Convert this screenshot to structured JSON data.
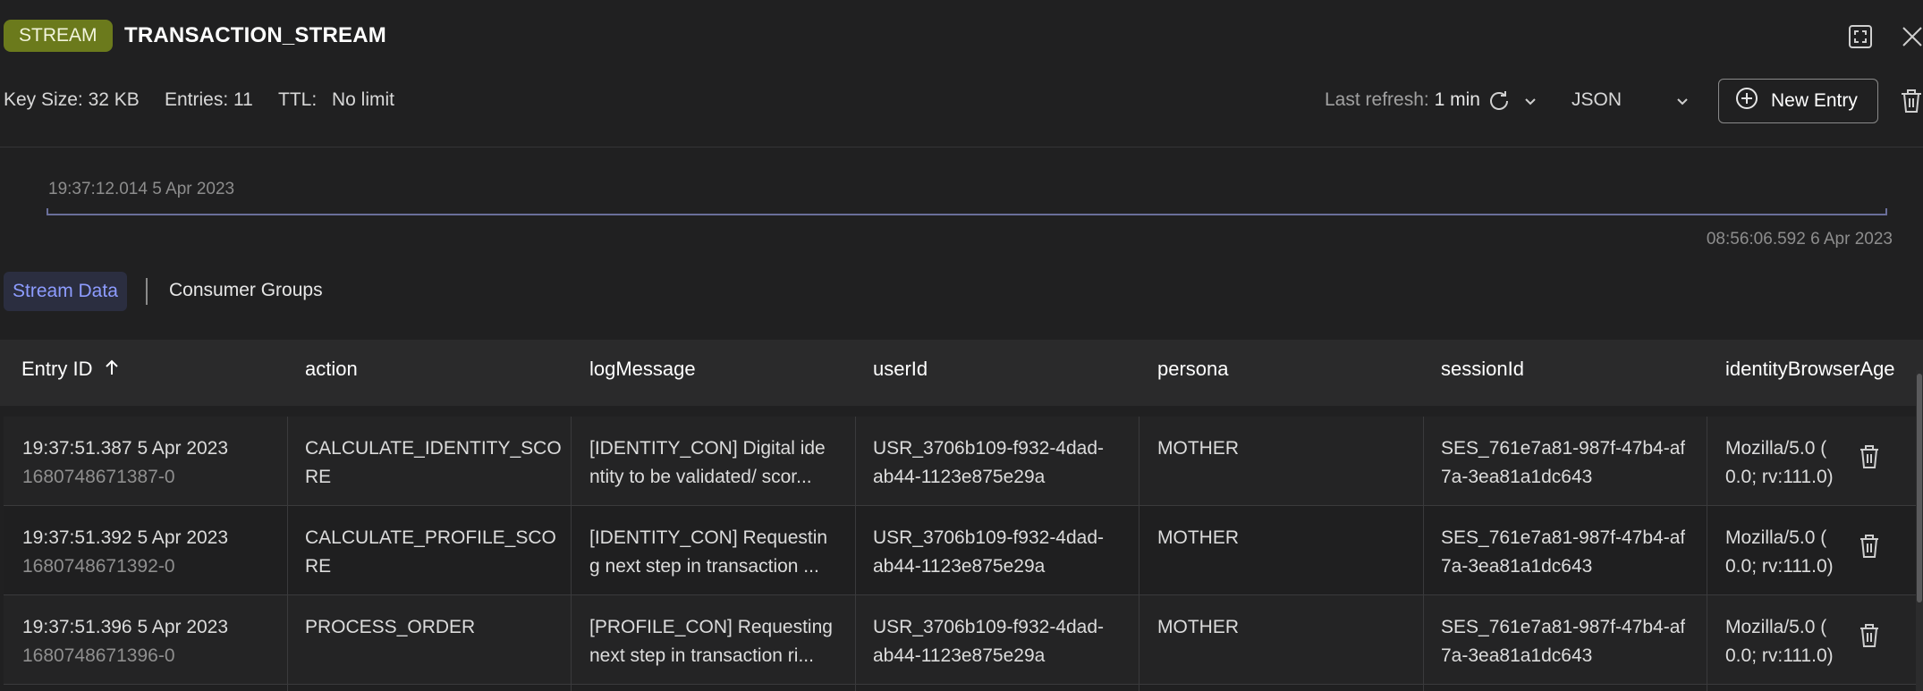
{
  "header": {
    "badge": "STREAM",
    "key_name": "TRANSACTION_STREAM",
    "key_size_label": "Key Size:",
    "key_size": "32 KB",
    "entries_label": "Entries:",
    "entries": "11",
    "ttl_label": "TTL:",
    "ttl": "No limit",
    "last_refresh_label": "Last refresh:",
    "last_refresh": "1 min",
    "format": "JSON",
    "new_entry": "New Entry"
  },
  "timeline": {
    "start": "19:37:12.014 5 Apr 2023",
    "end": "08:56:06.592 6 Apr 2023"
  },
  "tabs": {
    "stream_data": "Stream Data",
    "consumer_groups": "Consumer Groups"
  },
  "table": {
    "columns": [
      "Entry ID",
      "action",
      "logMessage",
      "userId",
      "persona",
      "sessionId",
      "identityBrowserAge"
    ],
    "rows": [
      {
        "time": "19:37:51.387 5 Apr 2023",
        "id": "1680748671387-0",
        "action_1": "CALCULATE_IDENTITY_SCO",
        "action_2": "RE",
        "log_1": "[IDENTITY_CON] Digital ide",
        "log_2": "ntity to be validated/ scor...",
        "user_1": "USR_3706b109-f932-4dad-",
        "user_2": "ab44-1123e875e29a",
        "persona": "MOTHER",
        "session_1": "SES_761e7a81-987f-47b4-af",
        "session_2": "7a-3ea81a1dc643",
        "browser_1": "Mozilla/5.0 (",
        "browser_2": "0.0; rv:111.0)"
      },
      {
        "time": "19:37:51.392 5 Apr 2023",
        "id": "1680748671392-0",
        "action_1": "CALCULATE_PROFILE_SCO",
        "action_2": "RE",
        "log_1": "[IDENTITY_CON] Requestin",
        "log_2": "g next step in transaction ...",
        "user_1": "USR_3706b109-f932-4dad-",
        "user_2": "ab44-1123e875e29a",
        "persona": "MOTHER",
        "session_1": "SES_761e7a81-987f-47b4-af",
        "session_2": "7a-3ea81a1dc643",
        "browser_1": "Mozilla/5.0 (",
        "browser_2": "0.0; rv:111.0)"
      },
      {
        "time": "19:37:51.396 5 Apr 2023",
        "id": "1680748671396-0",
        "action_1": "PROCESS_ORDER",
        "action_2": "",
        "log_1": "[PROFILE_CON] Requesting",
        "log_2": "next step in transaction ri...",
        "user_1": "USR_3706b109-f932-4dad-",
        "user_2": "ab44-1123e875e29a",
        "persona": "MOTHER",
        "session_1": "SES_761e7a81-987f-47b4-af",
        "session_2": "7a-3ea81a1dc643",
        "browser_1": "Mozilla/5.0 (",
        "browser_2": "0.0; rv:111.0)"
      }
    ]
  },
  "colors": {
    "badge": "#6b7a1c",
    "accent": "#8d9cff",
    "background": "#202021"
  }
}
